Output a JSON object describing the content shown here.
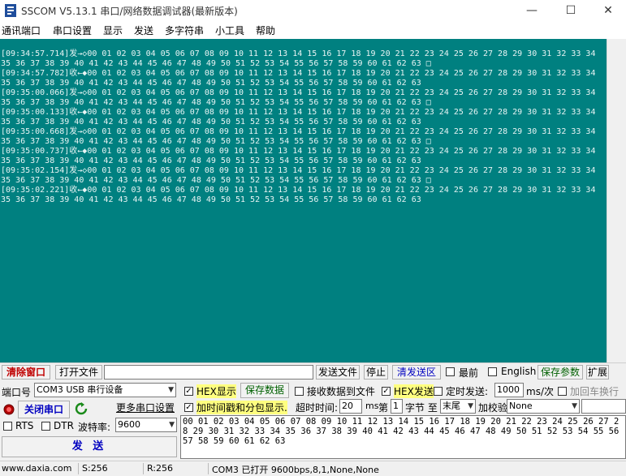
{
  "window": {
    "title": "SSCOM V5.13.1 串口/网络数据调试器(最新版本)",
    "minimize": "—",
    "maximize": "☐",
    "close": "✕"
  },
  "menu": [
    "通讯端口",
    "串口设置",
    "显示",
    "发送",
    "多字符串",
    "小工具",
    "帮助"
  ],
  "receive_log": [
    "[09:34:57.714]发→◇00 01 02 03 04 05 06 07 08 09 10 11 12 13 14 15 16 17 18 19 20 21 22 23 24 25 26 27 28 29 30 31 32 33 34",
    "35 36 37 38 39 40 41 42 43 44 45 46 47 48 49 50 51 52 53 54 55 56 57 58 59 60 61 62 63 □",
    "[09:34:57.782]收←◆00 01 02 03 04 05 06 07 08 09 10 11 12 13 14 15 16 17 18 19 20 21 22 23 24 25 26 27 28 29 30 31 32 33 34",
    "35 36 37 38 39 40 41 42 43 44 45 46 47 48 49 50 51 52 53 54 55 56 57 58 59 60 61 62 63",
    "[09:35:00.066]发→◇00 01 02 03 04 05 06 07 08 09 10 11 12 13 14 15 16 17 18 19 20 21 22 23 24 25 26 27 28 29 30 31 32 33 34",
    "35 36 37 38 39 40 41 42 43 44 45 46 47 48 49 50 51 52 53 54 55 56 57 58 59 60 61 62 63 □",
    "[09:35:00.133]收←◆00 01 02 03 04 05 06 07 08 09 10 11 12 13 14 15 16 17 18 19 20 21 22 23 24 25 26 27 28 29 30 31 32 33 34",
    "35 36 37 38 39 40 41 42 43 44 45 46 47 48 49 50 51 52 53 54 55 56 57 58 59 60 61 62 63",
    "[09:35:00.668]发→◇00 01 02 03 04 05 06 07 08 09 10 11 12 13 14 15 16 17 18 19 20 21 22 23 24 25 26 27 28 29 30 31 32 33 34",
    "35 36 37 38 39 40 41 42 43 44 45 46 47 48 49 50 51 52 53 54 55 56 57 58 59 60 61 62 63 □",
    "[09:35:00.737]收←◆00 01 02 03 04 05 06 07 08 09 10 11 12 13 14 15 16 17 18 19 20 21 22 23 24 25 26 27 28 29 30 31 32 33 34",
    "35 36 37 38 39 40 41 42 43 44 45 46 47 48 49 50 51 52 53 54 55 56 57 58 59 60 61 62 63",
    "[09:35:02.154]发→◇00 01 02 03 04 05 06 07 08 09 10 11 12 13 14 15 16 17 18 19 20 21 22 23 24 25 26 27 28 29 30 31 32 33 34",
    "35 36 37 38 39 40 41 42 43 44 45 46 47 48 49 50 51 52 53 54 55 56 57 58 59 60 61 62 63 □",
    "[09:35:02.221]收←◆00 01 02 03 04 05 06 07 08 09 10 11 12 13 14 15 16 17 18 19 20 21 22 23 24 25 26 27 28 29 30 31 32 33 34",
    "35 36 37 38 39 40 41 42 43 44 45 46 47 48 49 50 51 52 53 54 55 56 57 58 59 60 61 62 63"
  ],
  "toolbar1": {
    "clear_window": "清除窗口",
    "open_file": "打开文件",
    "file_path": "",
    "send_file": "发送文件",
    "stop": "停止",
    "clear_send": "清发送区",
    "topmost": "最前",
    "english": "English",
    "save_params": "保存参数",
    "expand": "扩展"
  },
  "port": {
    "label": "端口号",
    "value": "COM3 USB 串行设备",
    "close_port": "关闭串口",
    "more_settings": "更多串口设置",
    "rts": "RTS",
    "dtr": "DTR",
    "baud_label": "波特率:",
    "baud_value": "9600",
    "send_button": "发 送"
  },
  "options": {
    "hex_display": "HEX显示",
    "save_data": "保存数据",
    "recv_to_file": "接收数据到文件",
    "hex_send": "HEX发送",
    "timed_send": "定时发送:",
    "interval_value": "1000",
    "interval_unit": "ms/次",
    "add_crlf": "加回车换行",
    "timestamp": "加时间戳和分包显示.",
    "timeout_label": "超时时间:",
    "timeout_value": "20",
    "timeout_unit": "ms",
    "byte_prefix": "第",
    "byte_index": "1",
    "byte_mid": "字节 至",
    "tail_value": "末尾",
    "checksum_label": "加校验",
    "checksum_value": "None"
  },
  "send_data": "00 01 02 03 04 05 06 07 08 09 10 11 12 13 14 15 16 17 18 19 20 21 22 23 24 25 26 27 28 29 30 31 32 33 34 35 36 37 38 39 40 41 42 43 44 45 46 47 48 49 50 51 52 53 54 55 56 57 58 59 60 61 62 63",
  "status": {
    "website": "www.daxia.com",
    "sent": "S:256",
    "received": "R:256",
    "port_info": "COM3 已打开  9600bps,8,1,None,None"
  },
  "colors": {
    "receive_bg": "#008080",
    "highlight": "#ffff80",
    "accent_red": "#c00000",
    "accent_blue": "#0000c0"
  }
}
